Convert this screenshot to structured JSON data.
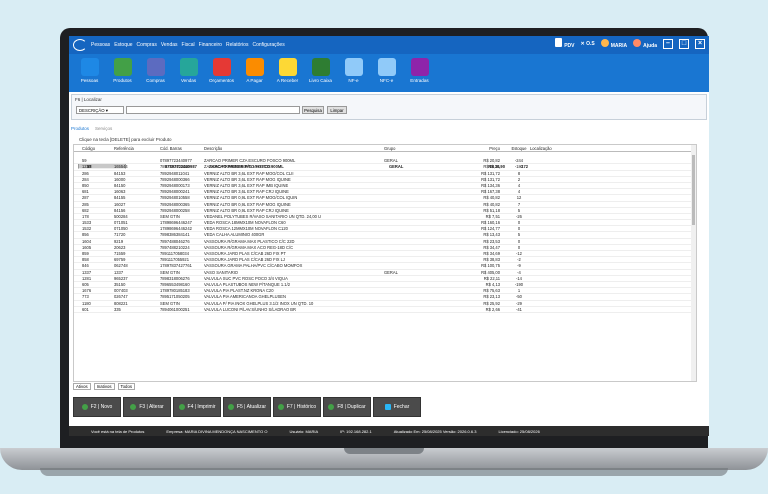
{
  "titlebar": {
    "menu": [
      "Pessoas",
      "Estoque",
      "Compras",
      "Vendas",
      "Fiscal",
      "Financeiro",
      "Relatórios",
      "Configurações"
    ],
    "pdv": "PDV",
    "os": "O.S",
    "user": "MARIA",
    "help": "Ajuda"
  },
  "toolbar": {
    "items": [
      {
        "label": "Pessoas",
        "color": "#1e88e5"
      },
      {
        "label": "Produtos",
        "color": "#43a047"
      },
      {
        "label": "Compras",
        "color": "#5c6bc0"
      },
      {
        "label": "Vendas",
        "color": "#26a69a"
      },
      {
        "label": "Orçamentos",
        "color": "#e53935"
      },
      {
        "label": "A Pagar",
        "color": "#fb8c00"
      },
      {
        "label": "A Receber",
        "color": "#fdd835"
      },
      {
        "label": "Livro Caixa",
        "color": "#2e7d32"
      },
      {
        "label": "NF-e",
        "color": "#90caf9"
      },
      {
        "label": "NFC-e",
        "color": "#90caf9"
      },
      {
        "label": "Entradas",
        "color": "#8e24aa"
      }
    ]
  },
  "search": {
    "label": "F6 | Localizar",
    "field": "DESCRIÇÃO",
    "search_btn": "Pesquisa",
    "clear_btn": "Limpar"
  },
  "tabs": {
    "active": "Produtos",
    "inactive": "Serviços"
  },
  "hint": "Clique na tecla [DELETE] para excluir Produto",
  "grid": {
    "headers": [
      "Código",
      "Referência",
      "Cód. Barras",
      "Descrição",
      "Grupo",
      "Preço",
      "Estoque",
      "Localização"
    ],
    "rows": [
      [
        "58",
        "",
        "07897723440987",
        "ZARCAO PRIMER P/TO FOSCO 900ML",
        "GERAL",
        "R$ 36,90",
        "-172",
        ""
      ],
      [
        "59",
        "",
        "07897723440977",
        "ZARCAO PRIMER CZA ESCURO FOSCO 900ML",
        "GERAL",
        "R$ 20,82",
        "-244",
        ""
      ],
      [
        "1237",
        "165544",
        "7897723401060",
        "ZARCAO PRIMER 900ML VER FOS",
        "",
        "R$ 28,21",
        "-182",
        ""
      ],
      [
        "286",
        "84153",
        "7892948011041",
        "VERNIZ ALTO BR 3,6L EXT RAP MOG/COL CLII",
        "",
        "R$ 131,72",
        "8",
        ""
      ],
      [
        "284",
        "16000",
        "7892948000366",
        "VERNIZ ALTO BR 3,6L EXT RAP MOG IQUINE",
        "",
        "R$ 131,72",
        "2",
        ""
      ],
      [
        "850",
        "84150",
        "7892948000173",
        "VERNIZ ALTO BR 3,6L EXT RAP IMB IQUINE",
        "",
        "R$ 134,36",
        "4",
        ""
      ],
      [
        "681",
        "16063",
        "7892948000241",
        "VERNIZ ALTO BR 3,6L EXT RAP CRJ IQUINE",
        "",
        "R$ 167,38",
        "4",
        ""
      ],
      [
        "287",
        "84155",
        "7892948010558",
        "VERNIZ ALTO BR 0,9L EXT RAP MOG/COL IQUIN",
        "",
        "R$ 40,82",
        "12",
        ""
      ],
      [
        "285",
        "16027",
        "7892948000365",
        "VERNIZ ALTO BR 0,9L EXT RAP MOG IQUINE",
        "",
        "R$ 40,82",
        "7",
        ""
      ],
      [
        "682",
        "84156",
        "7892948000258",
        "VERNIZ ALTO BR 0,9L EXT RAP CRJ IQUINE",
        "",
        "R$ 51,18",
        "5",
        ""
      ],
      [
        "178",
        "500284",
        "SEM GTIN",
        "VEDANEL POLYTUBES R/VASO SANITARIO UN QTD. 24,00 U",
        "",
        "R$ 7,51",
        "-26",
        ""
      ],
      [
        "1533",
        "071051",
        "17898696446247",
        "VEDA ROSCA 18MMX10M NOVAFLON C60",
        "",
        "R$ 160,16",
        "0",
        ""
      ],
      [
        "1532",
        "071050",
        "17898696446242",
        "VEDA ROSCA 12MMX10M NOVAFLON C120",
        "",
        "R$ 124,77",
        "0",
        ""
      ],
      [
        "856",
        "71720",
        "7898386384141",
        "VEDA CALHA ALUMINIO 400GR",
        "",
        "R$ 13,43",
        "5",
        ""
      ],
      [
        "1604",
        "9219",
        "7897488046276",
        "VASSOURA R/GRAMA MAX PLASTICO C/C 22D",
        "",
        "R$ 23,53",
        "0",
        ""
      ],
      [
        "1605",
        "20623",
        "7897488210224",
        "VASSOURA R/GRAMA MAX ACO REG-18D C/C",
        "",
        "R$ 34,47",
        "0",
        ""
      ],
      [
        "859",
        "71559",
        "7891117058034",
        "VASSOURA JARD PLAS C/CAB 26D FIX PT",
        "",
        "R$ 34,69",
        "-12",
        ""
      ],
      [
        "858",
        "69759",
        "7891117055921",
        "VASSOURA JARD PLAS C/CAB 26D FIX LJ",
        "",
        "R$ 38,83",
        "-2",
        ""
      ],
      [
        "846",
        "062748",
        "17897837427761",
        "VASSOURA GRAMA PALHA/PVC C/CABO MOMFOX",
        "",
        "R$ 100,75",
        "-9",
        ""
      ],
      [
        "1337",
        "1337",
        "SEM GTIN",
        "VASO SANITARIO",
        "GERAL",
        "R$ 405,00",
        "-4",
        ""
      ],
      [
        "1281",
        "965237",
        "7898318006276",
        "VALVULA SUC PVC ROSC POCO 3/4 VIQUA",
        "",
        "R$ 22,11",
        "-14",
        ""
      ],
      [
        "605",
        "35150",
        "7896553498160",
        "VALVULA PLASTUBOS NEW P/TANQUE 1.1/2",
        "",
        "R$ 4,13",
        "-190",
        ""
      ],
      [
        "1676",
        "007403",
        "1789780185183",
        "VALVULA PIA PLAST.NZ KRONA C20",
        "",
        "R$ 75,63",
        "1",
        ""
      ],
      [
        "773",
        "026747",
        "7895171050205",
        "VALVULA PIA AMERICANOA GHELPLUSEN",
        "",
        "R$ 23,13",
        "-50",
        ""
      ],
      [
        "1180",
        "808221",
        "SEM GTIN",
        "VALVULA P/ PIA INOX GHELPLUS 3.1/2 INOX UN QTD. 10",
        "",
        "R$ 25,92",
        "-29",
        ""
      ],
      [
        "601",
        "335",
        "7894061000251",
        "VALVULA LUCONI P/LAV.S/UNHO S/LADRAO BR",
        "",
        "R$ 2,66",
        "-41",
        ""
      ]
    ]
  },
  "footer_tabs": [
    "Ativos",
    "Inativos",
    "Todos"
  ],
  "footer_buttons": [
    {
      "label": "F2 | Novo",
      "icon": "green"
    },
    {
      "label": "F3 | Alterar",
      "icon": "green"
    },
    {
      "label": "F4 | Imprimir",
      "icon": "green"
    },
    {
      "label": "F5 | Atualizar",
      "icon": "green"
    },
    {
      "label": "F7 | Histórico",
      "icon": "green"
    },
    {
      "label": "F8 | Duplicar",
      "icon": "green"
    },
    {
      "label": "Fechar",
      "icon": "blue"
    }
  ],
  "statusbar": {
    "screen": "Você está na tela de Produtos",
    "company": "Empresa: MARIA DIVINA MENDONÇA NASCIMENTO O",
    "user": "Usuário: MARIA",
    "ip": "IP: 192.168.282.1",
    "updated": "Atualizado Em: 25/08/2025  Versão: 2026.0.6.3",
    "license": "Licenciado: 25/08/2026"
  }
}
